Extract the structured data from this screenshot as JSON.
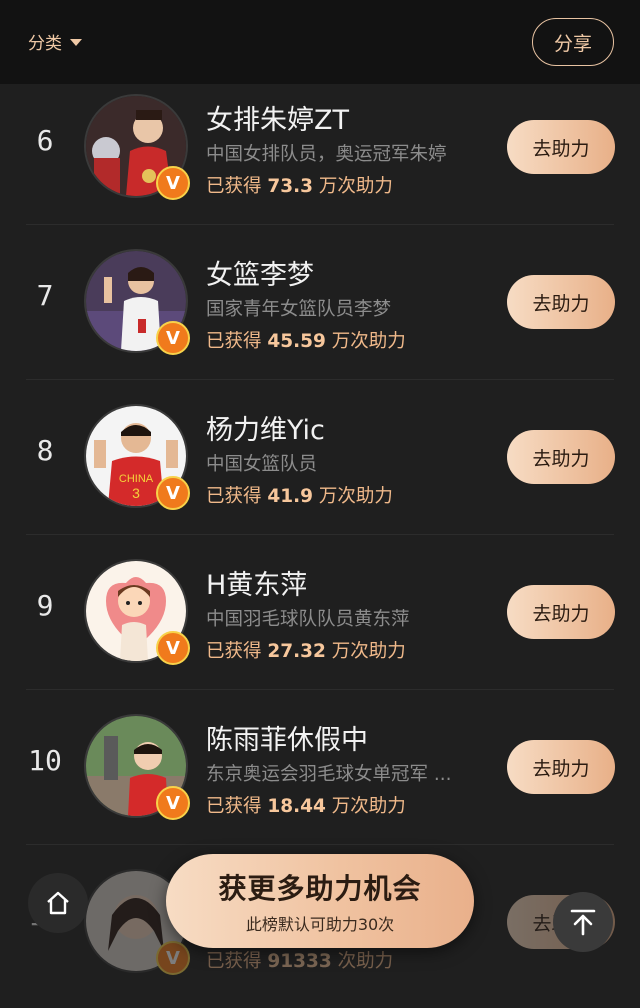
{
  "header": {
    "category_label": "分类",
    "share_label": "分享"
  },
  "list": [
    {
      "rank": "6",
      "name": "女排朱婷ZT",
      "desc": "中国女排队员，奥运冠军朱婷",
      "stat_prefix": "已获得 ",
      "stat_value": "73.3",
      "stat_suffix": " 万次助力",
      "button": "去助力",
      "verified": "V"
    },
    {
      "rank": "7",
      "name": "女篮李梦",
      "desc": "国家青年女篮队员李梦",
      "stat_prefix": "已获得 ",
      "stat_value": "45.59",
      "stat_suffix": " 万次助力",
      "button": "去助力",
      "verified": "V"
    },
    {
      "rank": "8",
      "name": "杨力维Yic",
      "desc": "中国女篮队员",
      "stat_prefix": "已获得 ",
      "stat_value": "41.9",
      "stat_suffix": " 万次助力",
      "button": "去助力",
      "verified": "V"
    },
    {
      "rank": "9",
      "name": "H黄东萍",
      "desc": "中国羽毛球队队员黄东萍",
      "stat_prefix": "已获得 ",
      "stat_value": "27.32",
      "stat_suffix": " 万次助力",
      "button": "去助力",
      "verified": "V"
    },
    {
      "rank": "10",
      "name": "陈雨菲休假中",
      "desc": "东京奥运会羽毛球女单冠军 ...",
      "stat_prefix": "已获得 ",
      "stat_value": "18.44",
      "stat_suffix": " 万次助力",
      "button": "去助力",
      "verified": "V"
    },
    {
      "rank": "11",
      "name": "",
      "desc": "",
      "stat_prefix": "已获得 ",
      "stat_value": "91333",
      "stat_suffix": " 次助力",
      "button": "去助力",
      "verified": "V"
    }
  ],
  "cta": {
    "title": "获更多助力机会",
    "subtitle": "此榜默认可助力30次"
  },
  "icons": {
    "home": "home-icon",
    "back_to_top": "arrow-up-icon",
    "category_caret": "caret-down-icon"
  },
  "colors": {
    "accent": "#f0c9a6",
    "badge": "#f07a1c",
    "background": "#1f1f1f"
  }
}
